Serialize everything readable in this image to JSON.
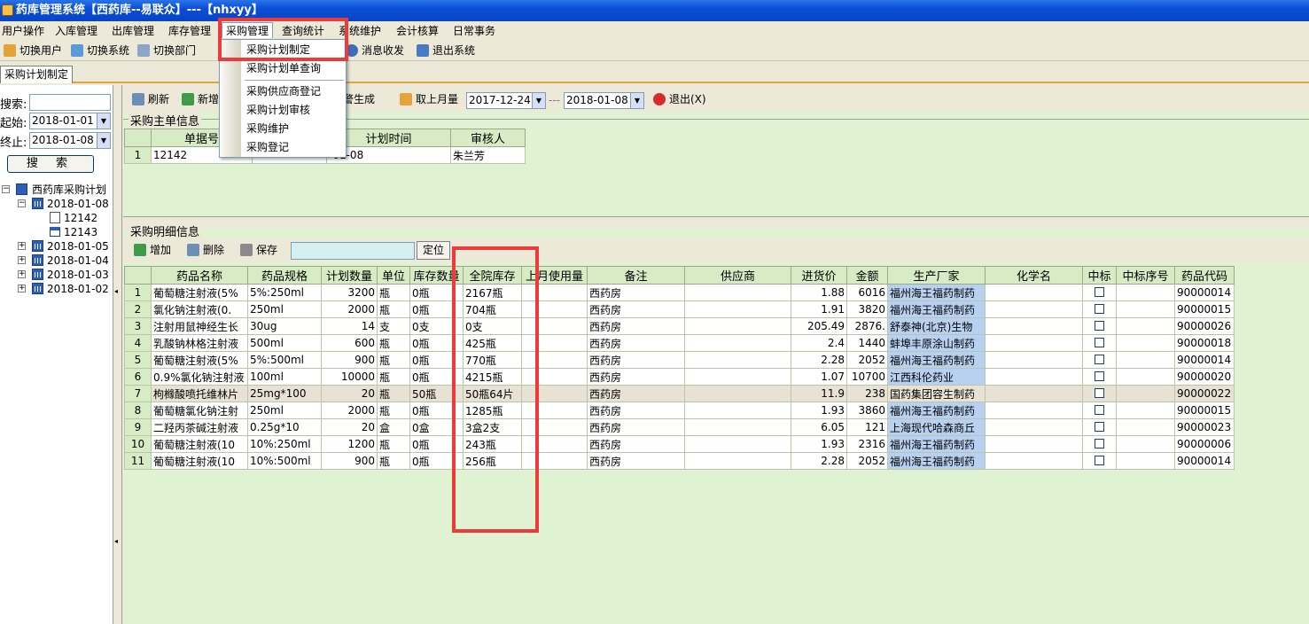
{
  "window": {
    "title": "药库管理系统【西药库--易联众】---【nhxyy】"
  },
  "menubar": [
    "用户操作",
    "入库管理",
    "出库管理",
    "库存管理",
    "采购管理",
    "查询统计",
    "系统维护",
    "会计核算",
    "日常事务"
  ],
  "menu_active": "采购管理",
  "toolbar": {
    "switch_user": "切换用户",
    "switch_system": "切换系统",
    "switch_dept": "切换部门",
    "message": "消息收发",
    "exit_system": "退出系统"
  },
  "dropdown": [
    "采购计划制定",
    "采购计划单查询",
    "采购供应商登记",
    "采购计划审核",
    "采购维护",
    "采购登记"
  ],
  "tab": {
    "label": "采购计划制定"
  },
  "left": {
    "search_label": "搜索:",
    "search_value": "",
    "start_label": "起始:",
    "start_value": "2018-01-01",
    "end_label": "终止:",
    "end_value": "2018-01-08",
    "search_button": "搜 索",
    "tree_root": "西药库采购计划",
    "tree": [
      {
        "date": "2018-01-08",
        "expanded": true,
        "children": [
          "12142",
          "12143"
        ]
      },
      {
        "date": "2018-01-05"
      },
      {
        "date": "2018-01-04"
      },
      {
        "date": "2018-01-03"
      },
      {
        "date": "2018-01-02"
      }
    ]
  },
  "main_toolbar": {
    "refresh": "刷新",
    "add": "新增",
    "warn_gen": "预警生成",
    "last_month": "取上月量",
    "date_from": "2017-12-24",
    "date_sep": "---",
    "date_to": "2018-01-08",
    "exit": "退出(X)"
  },
  "master": {
    "section": "采购主单信息",
    "headers": [
      "单据号",
      "",
      "计划时间",
      "审核人"
    ],
    "rows": [
      {
        "no": "1",
        "id": "12142",
        "c2": "",
        "time": "-01-08",
        "auditor": "朱兰芳"
      }
    ]
  },
  "detail": {
    "section": "采购明细信息",
    "add": "增加",
    "delete": "删除",
    "save": "保存",
    "locate_value": "",
    "locate": "定位",
    "headers": [
      "药品名称",
      "药品规格",
      "计划数量",
      "单位",
      "库存数量",
      "全院库存",
      "上月使用量",
      "备注",
      "供应商",
      "进货价",
      "金额",
      "生产厂家",
      "化学名",
      "中标",
      "中标序号",
      "药品代码"
    ],
    "rows": [
      [
        "1",
        "葡萄糖注射液(5%",
        "5%:250ml",
        "3200",
        "瓶",
        "0瓶",
        "2167瓶",
        "",
        "西药房",
        "",
        "1.88",
        "6016",
        "福州海王福药制药",
        "",
        "",
        "",
        "90000014"
      ],
      [
        "2",
        "氯化钠注射液(0.",
        "250ml",
        "2000",
        "瓶",
        "0瓶",
        "704瓶",
        "",
        "西药房",
        "",
        "1.91",
        "3820",
        "福州海王福药制药",
        "",
        "",
        "",
        "90000015"
      ],
      [
        "3",
        "注射用鼠神经生长",
        "30ug",
        "14",
        "支",
        "0支",
        "0支",
        "",
        "西药房",
        "",
        "205.49",
        "2876.",
        "舒泰神(北京)生物",
        "",
        "",
        "",
        "90000026"
      ],
      [
        "4",
        "乳酸钠林格注射液",
        "500ml",
        "600",
        "瓶",
        "0瓶",
        "425瓶",
        "",
        "西药房",
        "",
        "2.4",
        "1440",
        "蚌埠丰原涂山制药",
        "",
        "",
        "",
        "90000018"
      ],
      [
        "5",
        "葡萄糖注射液(5%",
        "5%:500ml",
        "900",
        "瓶",
        "0瓶",
        "770瓶",
        "",
        "西药房",
        "",
        "2.28",
        "2052",
        "福州海王福药制药",
        "",
        "",
        "",
        "90000014"
      ],
      [
        "6",
        "0.9%氯化钠注射液",
        "100ml",
        "10000",
        "瓶",
        "0瓶",
        "4215瓶",
        "",
        "西药房",
        "",
        "1.07",
        "10700",
        "江西科伦药业",
        "",
        "",
        "",
        "90000020"
      ],
      [
        "7",
        "枸橼酸喷托维林片",
        "25mg*100",
        "20",
        "瓶",
        "50瓶",
        "50瓶64片",
        "",
        "西药房",
        "",
        "11.9",
        "238",
        "国药集团容生制药",
        "",
        "",
        "",
        "90000022"
      ],
      [
        "8",
        "葡萄糖氯化钠注射",
        "250ml",
        "2000",
        "瓶",
        "0瓶",
        "1285瓶",
        "",
        "西药房",
        "",
        "1.93",
        "3860",
        "福州海王福药制药",
        "",
        "",
        "",
        "90000015"
      ],
      [
        "9",
        "二羟丙茶碱注射液",
        "0.25g*10",
        "20",
        "盒",
        "0盒",
        "3盒2支",
        "",
        "西药房",
        "",
        "6.05",
        "121",
        "上海现代哈森商丘",
        "",
        "",
        "",
        "90000023"
      ],
      [
        "10",
        "葡萄糖注射液(10",
        "10%:250ml",
        "1200",
        "瓶",
        "0瓶",
        "243瓶",
        "",
        "西药房",
        "",
        "1.93",
        "2316",
        "福州海王福药制药",
        "",
        "",
        "",
        "90000006"
      ],
      [
        "11",
        "葡萄糖注射液(10",
        "10%:500ml",
        "900",
        "瓶",
        "0瓶",
        "256瓶",
        "",
        "西药房",
        "",
        "2.28",
        "2052",
        "福州海王福药制药",
        "",
        "",
        "",
        "90000014"
      ]
    ]
  },
  "colors": {
    "title_bar": "#0a4ed6",
    "grid_bg": "#dff3d2",
    "header_bg": "#d7ecc5",
    "highlight": "#ee3a3a",
    "manufacturer_bg": "#b9d1f0"
  }
}
